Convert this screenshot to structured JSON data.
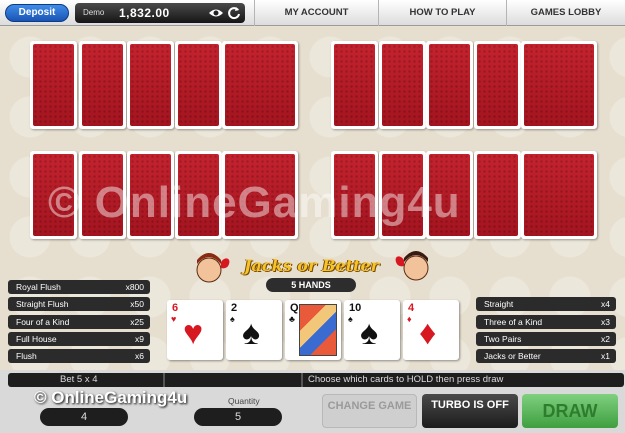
{
  "topbar": {
    "deposit_label": "Deposit",
    "mode_label": "Demo",
    "balance": "1,832.00",
    "nav": [
      "MY ACCOUNT",
      "HOW TO PLAY",
      "GAMES LOBBY"
    ]
  },
  "game": {
    "title": "Jacks or Better",
    "hands_label": "5 HANDS",
    "watermark": "© OnlineGaming4u"
  },
  "paytable_left": [
    {
      "name": "Royal Flush",
      "value": "x800"
    },
    {
      "name": "Straight Flush",
      "value": "x50"
    },
    {
      "name": "Four of a Kind",
      "value": "x25"
    },
    {
      "name": "Full House",
      "value": "x9"
    },
    {
      "name": "Flush",
      "value": "x6"
    }
  ],
  "paytable_right": [
    {
      "name": "Straight",
      "value": "x4"
    },
    {
      "name": "Three of a Kind",
      "value": "x3"
    },
    {
      "name": "Two Pairs",
      "value": "x2"
    },
    {
      "name": "Jacks or Better",
      "value": "x1"
    }
  ],
  "dealt_cards": [
    {
      "rank": "6",
      "suit": "♥",
      "color": "red"
    },
    {
      "rank": "2",
      "suit": "♠",
      "color": "black"
    },
    {
      "rank": "Q",
      "suit": "♣",
      "color": "black"
    },
    {
      "rank": "10",
      "suit": "♠",
      "color": "black"
    },
    {
      "rank": "4",
      "suit": "♦",
      "color": "red"
    }
  ],
  "controls": {
    "bet_text": "Bet 5 x 4",
    "message": "Choose which cards to HOLD then press draw",
    "bet_value": "4",
    "quantity_label": "Quantity",
    "quantity_value": "5",
    "change_game": "CHANGE GAME",
    "turbo": "TURBO IS OFF",
    "draw": "DRAW"
  },
  "colors": {
    "card_back": "#b51c27",
    "draw_button": "#5fbf5f",
    "deposit_button": "#2a6fd6"
  }
}
